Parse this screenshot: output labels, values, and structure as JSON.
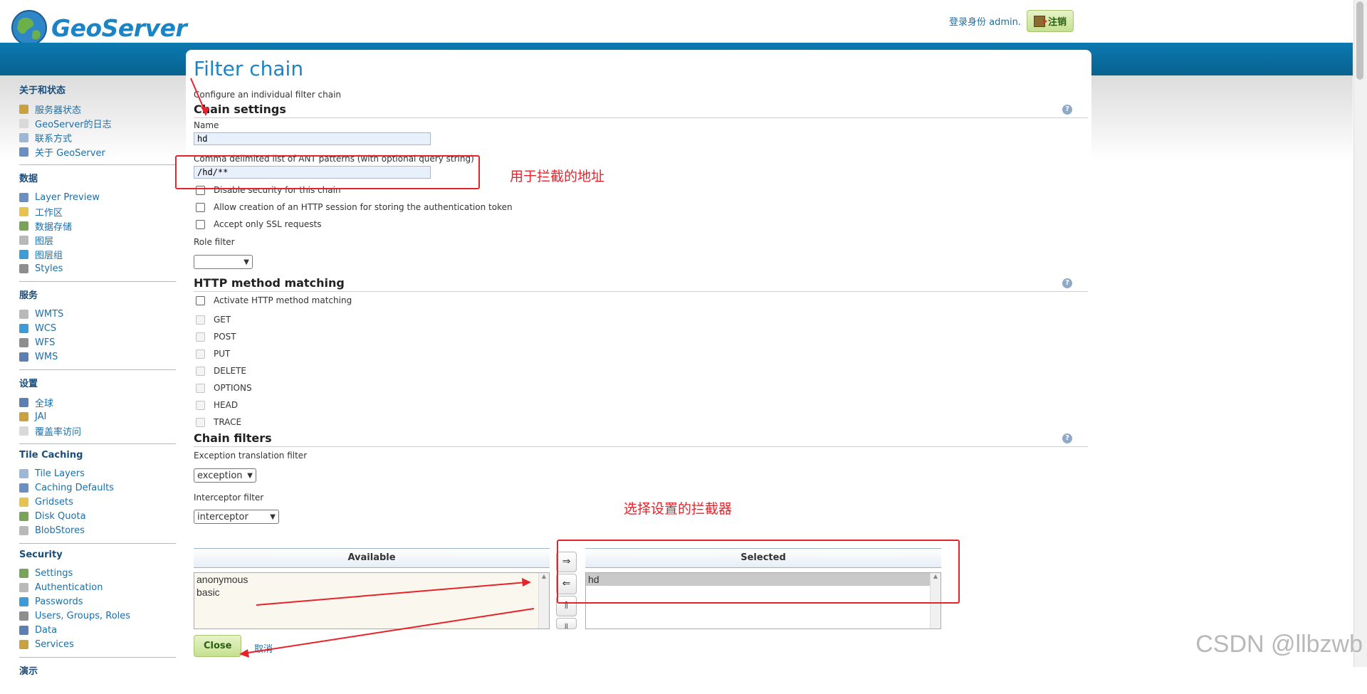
{
  "header": {
    "logo_text": "GeoServer",
    "user_label": "登录身份 admin.",
    "logout_label": "注销"
  },
  "sidebar": {
    "sections": [
      {
        "title": "关于和状态",
        "items": [
          "服务器状态",
          "GeoServer的日志",
          "联系方式",
          "关于 GeoServer"
        ]
      },
      {
        "title": "数据",
        "items": [
          "Layer Preview",
          "工作区",
          "数据存储",
          "图层",
          "图层组",
          "Styles"
        ]
      },
      {
        "title": "服务",
        "items": [
          "WMTS",
          "WCS",
          "WFS",
          "WMS"
        ]
      },
      {
        "title": "设置",
        "items": [
          "全球",
          "JAI",
          "覆盖率访问"
        ]
      },
      {
        "title": "Tile Caching",
        "items": [
          "Tile Layers",
          "Caching Defaults",
          "Gridsets",
          "Disk Quota",
          "BlobStores"
        ]
      },
      {
        "title": "Security",
        "items": [
          "Settings",
          "Authentication",
          "Passwords",
          "Users, Groups, Roles",
          "Data",
          "Services"
        ]
      },
      {
        "title": "演示",
        "items": []
      }
    ]
  },
  "main": {
    "title": "Filter chain",
    "description": "Configure an individual filter chain",
    "chain_settings": {
      "heading": "Chain settings",
      "name_label": "Name",
      "name_value": "hd",
      "patterns_label": "Comma delimited list of ANT patterns (with optional query string)",
      "patterns_value": "/hd/**",
      "checks": [
        "Disable security for this chain",
        "Allow creation of an HTTP session for storing the authentication token",
        "Accept only SSL requests"
      ],
      "role_filter_label": "Role filter",
      "role_filter_value": ""
    },
    "http_method": {
      "heading": "HTTP method matching",
      "activate_label": "Activate HTTP method matching",
      "methods": [
        "GET",
        "POST",
        "PUT",
        "DELETE",
        "OPTIONS",
        "HEAD",
        "TRACE"
      ]
    },
    "chain_filters": {
      "heading": "Chain filters",
      "exception_label": "Exception translation filter",
      "exception_value": "exception",
      "interceptor_label": "Interceptor filter",
      "interceptor_value": "interceptor",
      "available_header": "Available",
      "available_items": [
        "anonymous",
        "basic"
      ],
      "selected_header": "Selected",
      "selected_items": [
        "hd"
      ],
      "buttons": [
        "⇒",
        "⇐",
        "⇑",
        "⇓"
      ]
    },
    "close_label": "Close",
    "cancel_label": "取消"
  },
  "annotations": {
    "note1": "用于拦截的地址",
    "note2": "选择设置的拦截器",
    "color": "#e8222b"
  },
  "watermark": "CSDN @llbzwb",
  "colors": {
    "brand": "#1b84c6",
    "band": "#0b79b0",
    "button_green": "#c5e08f"
  }
}
